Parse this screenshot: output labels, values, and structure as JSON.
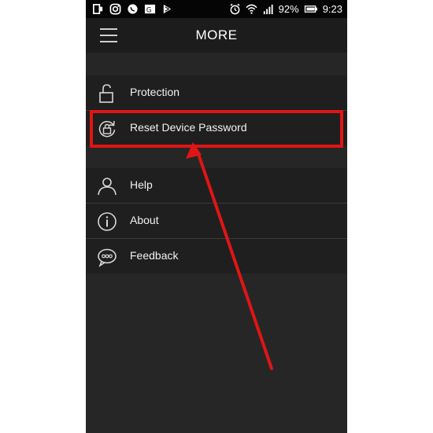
{
  "status_bar": {
    "battery_text": "92%",
    "time_text": "9:23"
  },
  "header": {
    "title": "MORE",
    "menu_icon": "hamburger-menu-icon"
  },
  "menu_groups": [
    {
      "items": [
        {
          "label": "Protection",
          "icon": "unlocked-padlock-icon"
        },
        {
          "label": "Reset Device Password",
          "icon": "reset-lock-icon"
        }
      ]
    },
    {
      "items": [
        {
          "label": "Help",
          "icon": "person-icon"
        },
        {
          "label": "About",
          "icon": "info-icon"
        },
        {
          "label": "Feedback",
          "icon": "chat-bubble-icon"
        }
      ]
    }
  ],
  "annotation": {
    "highlight_color": "#e01515",
    "highlighted_item": "Reset Device Password"
  }
}
